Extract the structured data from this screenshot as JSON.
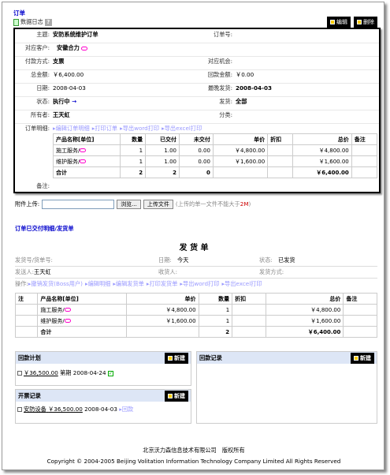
{
  "title": "订单",
  "data_log": "数据日志",
  "data_log_help": "?",
  "buttons": {
    "edit": "编辑",
    "delete": "删除"
  },
  "fields": {
    "subject_l": "主题:",
    "subject": "安防系统维护订单",
    "order_no_l": "订单号:",
    "customer_l": "对应客户:",
    "customer": "安徽合力",
    "pay_l": "付款方式:",
    "pay": "支票",
    "opp_l": "对应机会:",
    "total_l": "总金额:",
    "total": "￥6,400.00",
    "received_l": "回款金额:",
    "received": "￥0.00",
    "date_l": "日期:",
    "date": "2008-04-03",
    "latest_ship_l": "最晚发货:",
    "latest_ship": "2008-04-03",
    "status_l": "状态:",
    "status": "执行中",
    "ship_l": "发货:",
    "ship": "全部",
    "owner_l": "所有者:",
    "owner": "王天虹",
    "category_l": "分类:",
    "detail_l": "订单明细:",
    "remark_l": "备注:"
  },
  "detail_ops": [
    "编辑订单明细",
    "打印订单",
    "导出word打印",
    "导出excel打印"
  ],
  "order_table": {
    "headers": [
      "产品名称[单位]",
      "数量",
      "已交付",
      "未交付",
      "单价",
      "折扣",
      "总价",
      "备注"
    ],
    "rows": [
      [
        "施工服务/",
        "1",
        "1.00",
        "0.00",
        "￥4,800.00",
        "",
        "￥4,800.00",
        ""
      ],
      [
        "维护服务/",
        "1",
        "1.00",
        "0.00",
        "￥1,600.00",
        "",
        "￥1,600.00",
        ""
      ]
    ],
    "total": [
      "合计",
      "2",
      "2",
      "0",
      "",
      "",
      "￥6,400.00",
      ""
    ]
  },
  "upload": {
    "label": "附件上传:",
    "browse": "浏览...",
    "upload_btn": "上传文件",
    "note_pre": "(上传的单一文件不能大于",
    "note_size": "2M",
    ")": ")",
    "note_post": ")"
  },
  "delivery": {
    "section_title": "订单已交付明细/发货单",
    "heading": "发 货 单",
    "no_l": "发货号/货单号:",
    "date_l": "日期:",
    "date": "今天",
    "status_l": "状态:",
    "status": "已发货",
    "sender_l": "发送人:",
    "sender": "王天虹",
    "receiver_l": "收货人:",
    "method_l": "发货方式:",
    "ops_l": "操作:",
    "ops": [
      "撤销发货(Boss用户)",
      "编辑明细",
      "编辑发货单",
      "打印发货单",
      "导出word打印",
      "导出excel打印"
    ],
    "headers": [
      "注",
      "产品名称[单位]",
      "单价",
      "数量",
      "折扣",
      "总价",
      "备注"
    ],
    "rows": [
      [
        "",
        "施工服务/",
        "￥4,800.00",
        "1",
        "",
        "￥4,800.00",
        ""
      ],
      [
        "",
        "维护服务/",
        "￥1,600.00",
        "1",
        "",
        "￥1,600.00",
        ""
      ]
    ],
    "total": [
      "",
      "合计",
      "",
      "2",
      "",
      "￥6,400.00",
      ""
    ]
  },
  "plan": {
    "title": "回款计划",
    "new": "新建",
    "amount": "￥36,500.00",
    "period": "第期",
    "date": "2008-04-24"
  },
  "record": {
    "title": "回款记录",
    "new": "新建"
  },
  "invoice": {
    "title": "开票记录",
    "new": "新建",
    "item": "安防设备",
    "amount": "￥36,500.00",
    "date": "2008-04-03",
    "back": "回款"
  },
  "footer": {
    "company": "北京沃力森信息技术有限公司　版权所有",
    "copyright": "Copyright © 2004-2005 Beijing Volitation Information Technology Company Limited All Rights Reserved"
  }
}
